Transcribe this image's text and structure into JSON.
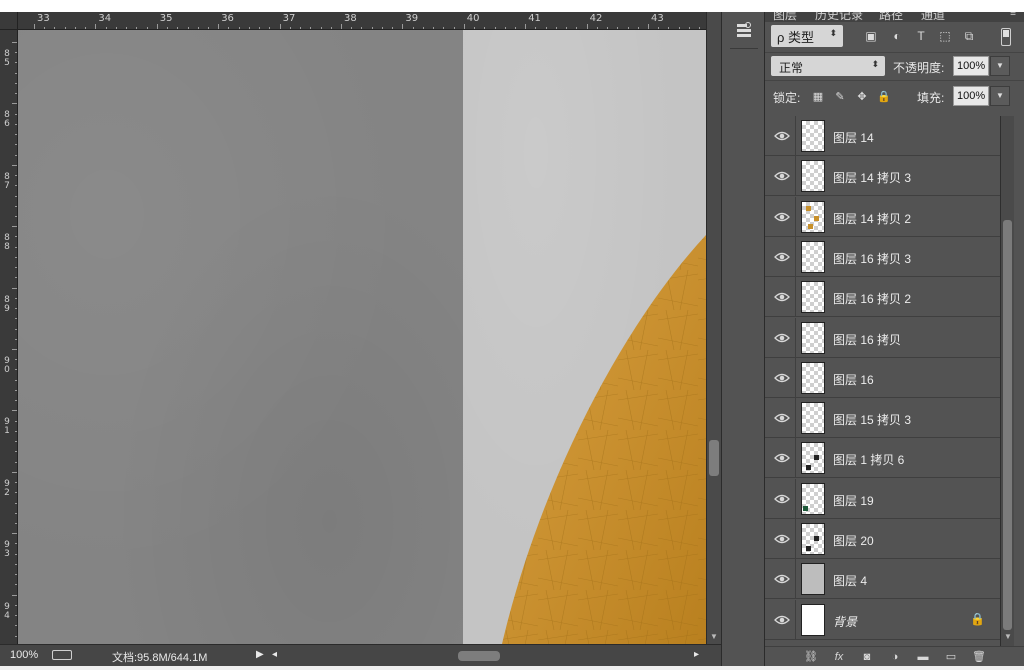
{
  "ruler": {
    "h_labels": [
      "33",
      "34",
      "35",
      "36",
      "37",
      "38",
      "39",
      "40",
      "41",
      "42",
      "43"
    ],
    "v_labels": [
      "8\n5",
      "8\n6",
      "8\n7",
      "8\n8",
      "8\n9",
      "9\n0",
      "9\n1",
      "9\n2",
      "9\n3",
      "9\n4"
    ]
  },
  "status": {
    "zoom": "100%",
    "doc": "文档:95.8M/644.1M"
  },
  "panel": {
    "tabs": [
      "图层",
      "历史记录",
      "路径",
      "通道"
    ],
    "filter_label": "ρ 类型",
    "blend_mode": "正常",
    "opacity_label": "不透明度:",
    "opacity_value": "100%",
    "lock_label": "锁定:",
    "fill_label": "填充:",
    "fill_value": "100%"
  },
  "layers": [
    {
      "name": "图层 14",
      "thumb": "checker"
    },
    {
      "name": "图层 14 拷贝 3",
      "thumb": "checker"
    },
    {
      "name": "图层 14 拷贝 2",
      "thumb": "checker-orange"
    },
    {
      "name": "图层 16 拷贝 3",
      "thumb": "checker"
    },
    {
      "name": "图层 16 拷贝 2",
      "thumb": "checker"
    },
    {
      "name": "图层 16 拷贝",
      "thumb": "checker"
    },
    {
      "name": "图层 16",
      "thumb": "checker"
    },
    {
      "name": "图层 15 拷贝 3",
      "thumb": "checker"
    },
    {
      "name": "图层 1 拷贝 6",
      "thumb": "checker-dark"
    },
    {
      "name": "图层 19",
      "thumb": "checker-green"
    },
    {
      "name": "图层 20",
      "thumb": "checker-dark"
    },
    {
      "name": "图层 4",
      "thumb": "gray"
    },
    {
      "name": "背景",
      "thumb": "white",
      "locked": true,
      "italic": true
    }
  ],
  "colors": {
    "ui_dark": "#535353",
    "canvas_left": "#848484",
    "canvas_right": "#c4c4c4",
    "gold": "#c8902a"
  }
}
